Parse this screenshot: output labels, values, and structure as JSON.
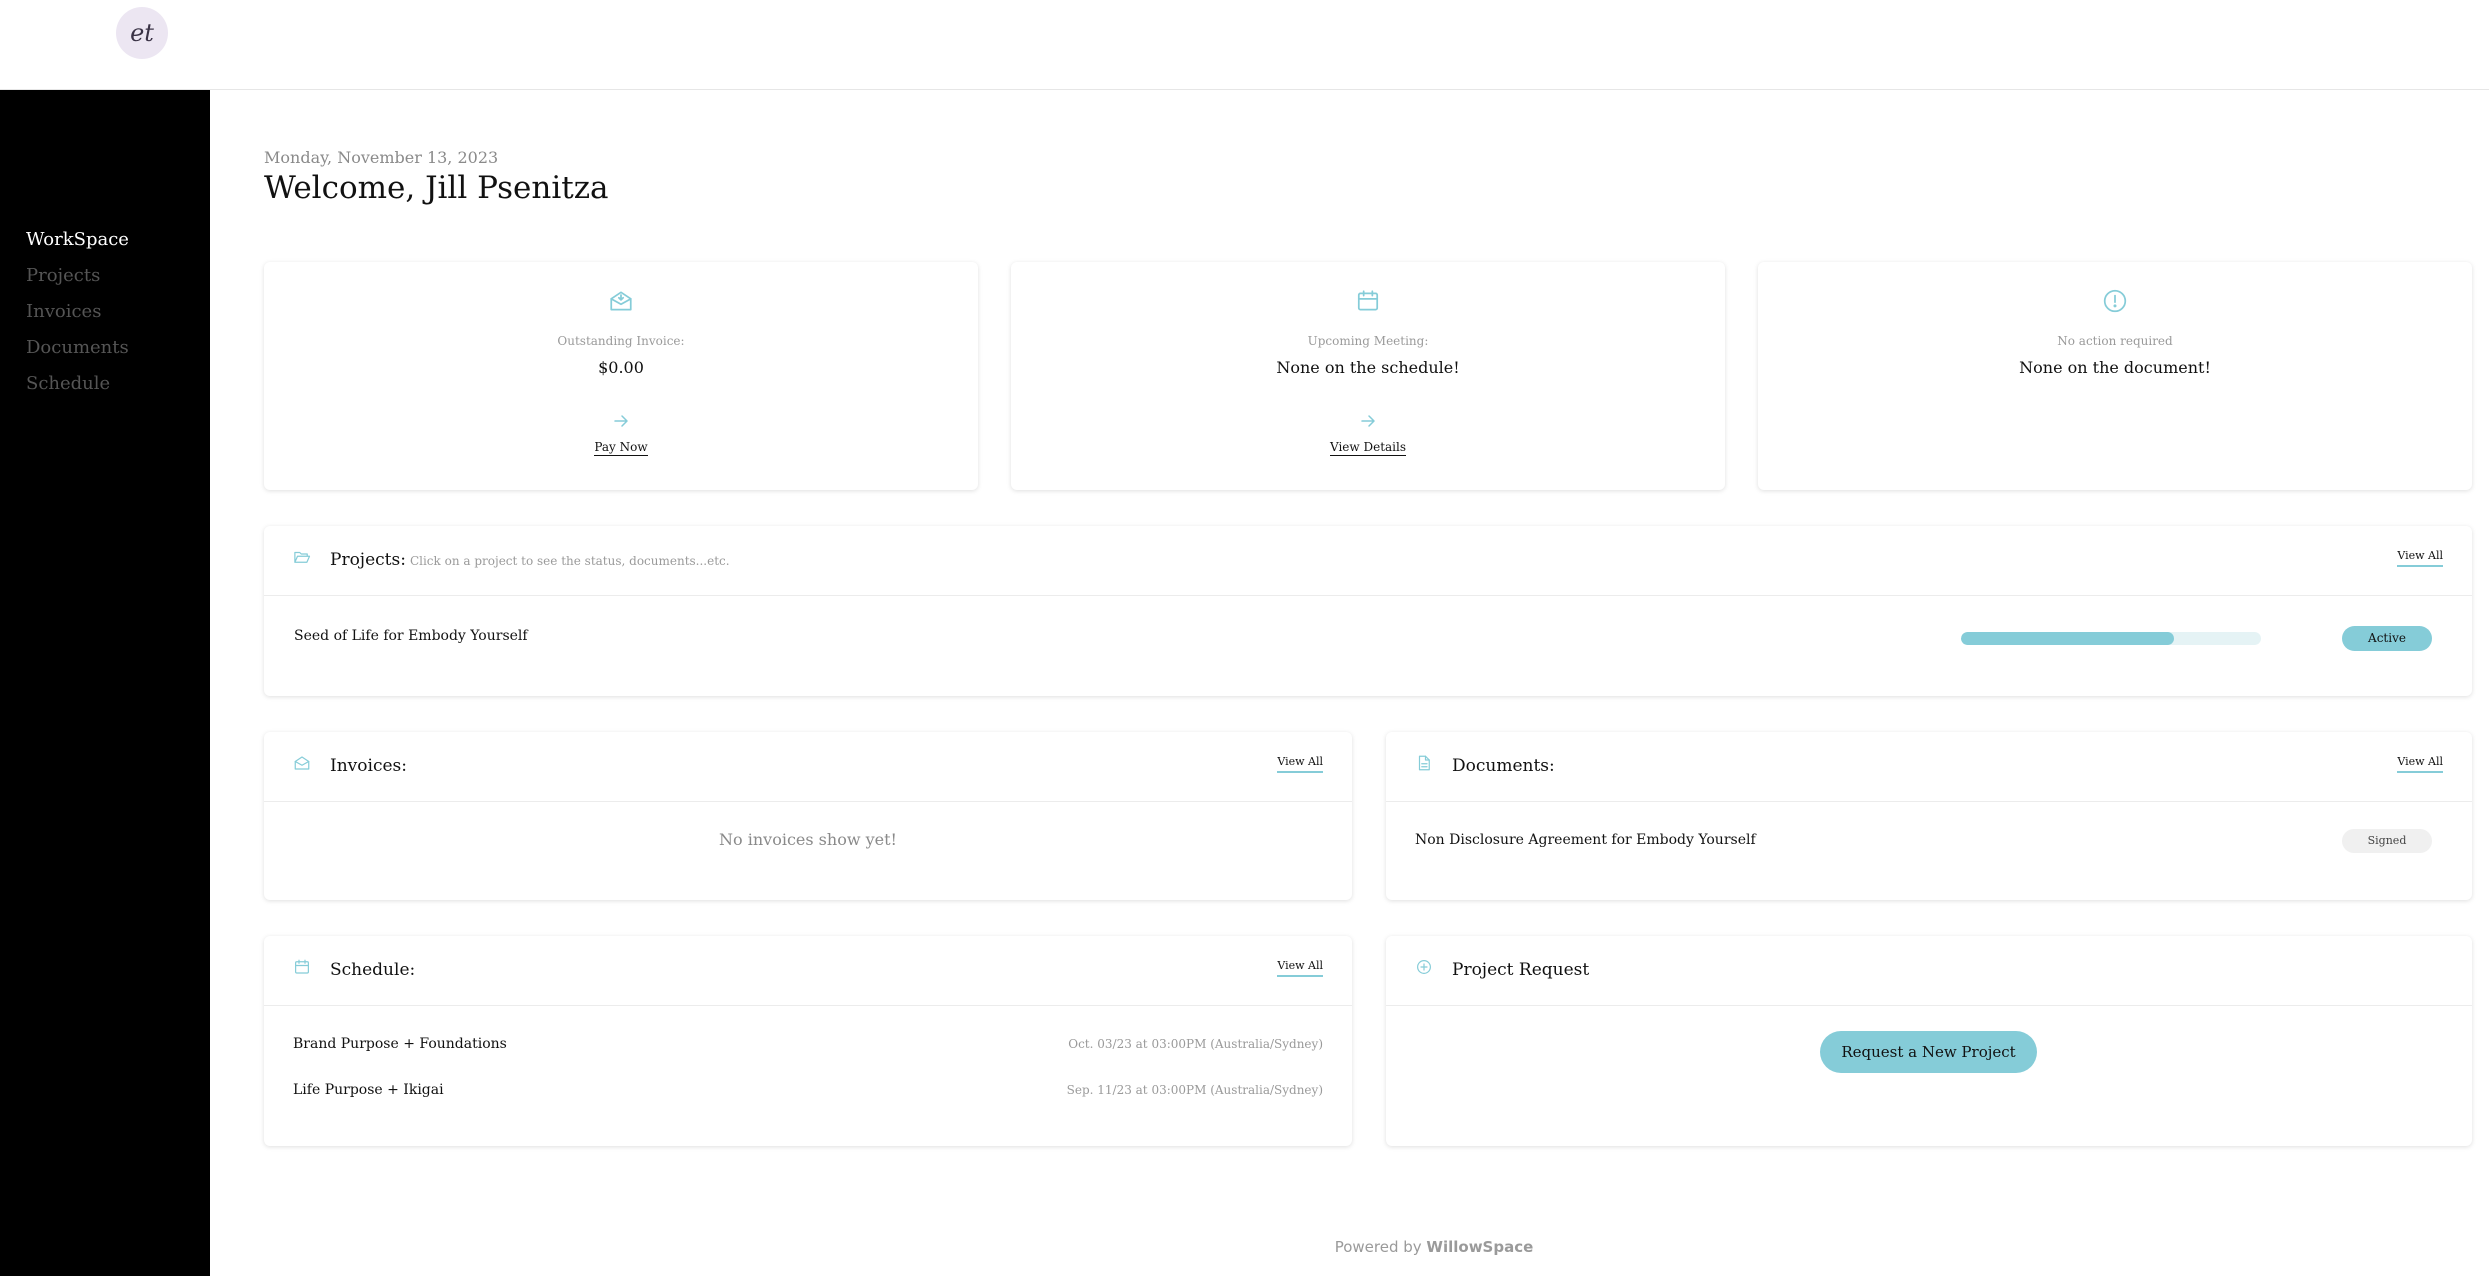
{
  "brand": {
    "logo_text": "et",
    "logo_icon": "brand-logo-icon"
  },
  "sidebar": {
    "items": [
      {
        "label": "WorkSpace",
        "active": true
      },
      {
        "label": "Projects",
        "active": false
      },
      {
        "label": "Invoices",
        "active": false
      },
      {
        "label": "Documents",
        "active": false
      },
      {
        "label": "Schedule",
        "active": false
      }
    ]
  },
  "header": {
    "date": "Monday, November 13, 2023",
    "welcome": "Welcome, Jill Psenitza"
  },
  "stats": [
    {
      "icon": "mail-inbox-icon",
      "label": "Outstanding Invoice:",
      "value": "$0.00",
      "link": "Pay Now"
    },
    {
      "icon": "calendar-icon",
      "label": "Upcoming Meeting:",
      "value": "None on the schedule!",
      "link": "View Details"
    },
    {
      "icon": "alert-circle-icon",
      "label": "No action required",
      "value": "None on the document!",
      "link": ""
    }
  ],
  "projects": {
    "title": "Projects:",
    "subtitle": "Click on a project to see the status, documents...etc.",
    "view_all": "View All",
    "items": [
      {
        "name": "Seed of Life for Embody Yourself",
        "progress": 0.71,
        "status": "Active"
      }
    ]
  },
  "invoices": {
    "title": "Invoices:",
    "view_all": "View All",
    "empty": "No invoices show yet!"
  },
  "documents": {
    "title": "Documents:",
    "view_all": "View All",
    "items": [
      {
        "name": "Non Disclosure Agreement for Embody Yourself",
        "status": "Signed"
      }
    ]
  },
  "schedule": {
    "title": "Schedule:",
    "view_all": "View All",
    "items": [
      {
        "title": "Brand Purpose + Foundations",
        "when": "Oct. 03/23 at 03:00PM (Australia/Sydney)"
      },
      {
        "title": "Life Purpose + Ikigai",
        "when": "Sep. 11/23 at 03:00PM (Australia/Sydney)"
      }
    ]
  },
  "request": {
    "title": "Project Request",
    "button": "Request a New Project"
  },
  "footer": {
    "prefix": "Powered by",
    "brand": "WillowSpace"
  },
  "colors": {
    "accent": "#85ccd8",
    "sidebar_bg": "#000000",
    "logo_bg": "#ece6f2"
  }
}
